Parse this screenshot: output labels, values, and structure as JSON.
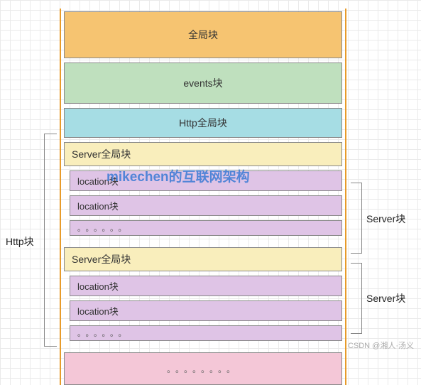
{
  "blocks": {
    "global": "全局块",
    "events": "events块",
    "http_global": "Http全局块",
    "server_global": "Server全局块",
    "location": "location块",
    "ellipsis": "。。。。。。",
    "ellipsis2": "。。。。。。。。"
  },
  "labels": {
    "http_block": "Http块",
    "server_block": "Server块"
  },
  "watermark": "mikechen的互联网架构",
  "footer": "CSDN @湘人·汤义"
}
